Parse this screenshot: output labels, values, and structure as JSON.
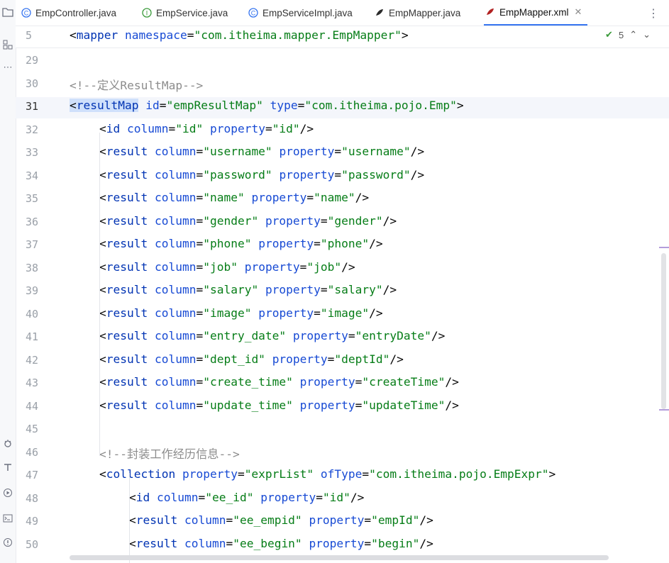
{
  "tabs": [
    {
      "label": "EmpController.java",
      "icon": "class-icon",
      "active": false
    },
    {
      "label": "EmpService.java",
      "icon": "interface-icon",
      "active": false
    },
    {
      "label": "EmpServiceImpl.java",
      "icon": "class-icon",
      "active": false
    },
    {
      "label": "EmpMapper.java",
      "icon": "mybatis-icon",
      "active": false
    },
    {
      "label": "EmpMapper.xml",
      "icon": "mybatis-icon",
      "active": true
    }
  ],
  "inspection": {
    "count": "5"
  },
  "sticky_line": {
    "num": "5",
    "code": "<mapper namespace=\"com.itheima.mapper.EmpMapper\">"
  },
  "lines": [
    {
      "num": "29",
      "code": ""
    },
    {
      "num": "30",
      "code": "<!--定义ResultMap-->"
    },
    {
      "num": "31",
      "code": "<resultMap id=\"empResultMap\" type=\"com.itheima.pojo.Emp\">"
    },
    {
      "num": "32",
      "code": "<id column=\"id\" property=\"id\"/>"
    },
    {
      "num": "33",
      "code": "<result column=\"username\" property=\"username\"/>"
    },
    {
      "num": "34",
      "code": "<result column=\"password\" property=\"password\"/>"
    },
    {
      "num": "35",
      "code": "<result column=\"name\" property=\"name\"/>"
    },
    {
      "num": "36",
      "code": "<result column=\"gender\" property=\"gender\"/>"
    },
    {
      "num": "37",
      "code": "<result column=\"phone\" property=\"phone\"/>"
    },
    {
      "num": "38",
      "code": "<result column=\"job\" property=\"job\"/>"
    },
    {
      "num": "39",
      "code": "<result column=\"salary\" property=\"salary\"/>"
    },
    {
      "num": "40",
      "code": "<result column=\"image\" property=\"image\"/>"
    },
    {
      "num": "41",
      "code": "<result column=\"entry_date\" property=\"entryDate\"/>"
    },
    {
      "num": "42",
      "code": "<result column=\"dept_id\" property=\"deptId\"/>"
    },
    {
      "num": "43",
      "code": "<result column=\"create_time\" property=\"createTime\"/>"
    },
    {
      "num": "44",
      "code": "<result column=\"update_time\" property=\"updateTime\"/>"
    },
    {
      "num": "45",
      "code": ""
    },
    {
      "num": "46",
      "code": "<!--封装工作经历信息-->"
    },
    {
      "num": "47",
      "code": "<collection property=\"exprList\" ofType=\"com.itheima.pojo.EmpExpr\">"
    },
    {
      "num": "48",
      "code": "<id column=\"ee_id\" property=\"id\"/>"
    },
    {
      "num": "49",
      "code": "<result column=\"ee_empid\" property=\"empId\"/>"
    },
    {
      "num": "50",
      "code": "<result column=\"ee_begin\" property=\"begin\"/>"
    }
  ],
  "current_line": "31",
  "colors": {
    "tag": "#0033b3",
    "attr": "#174ad4",
    "string": "#067d17",
    "comment": "#8c8c8c",
    "accent": "#3574f0"
  }
}
